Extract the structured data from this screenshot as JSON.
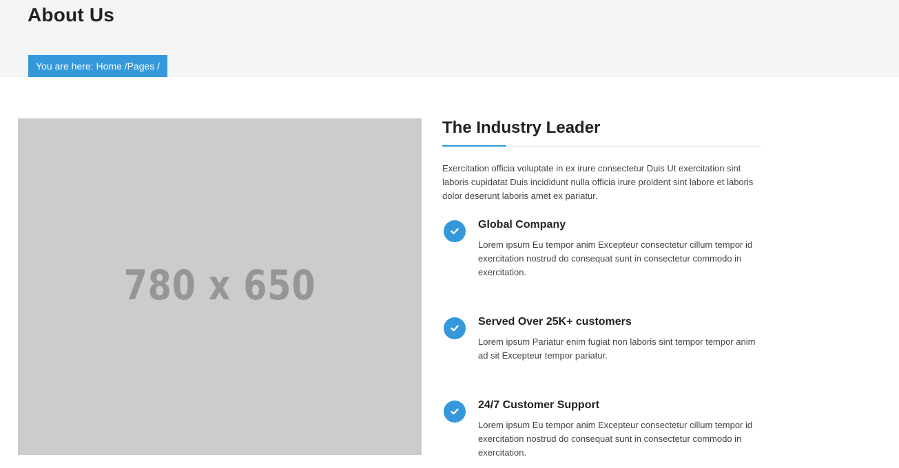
{
  "header": {
    "title": "About Us",
    "breadcrumb": {
      "prefix": "You are here: ",
      "items": [
        "Home /",
        "Pages /"
      ]
    }
  },
  "image": {
    "placeholder_text": "780 x 650"
  },
  "section": {
    "title": "The Industry Leader",
    "intro": "Exercitation officia voluptate in ex irure consectetur Duis Ut exercitation sint laboris cupidatat Duis incididunt nulla officia irure proident sint labore et laboris dolor deserunt laboris amet ex pariatur.",
    "features": [
      {
        "icon": "check-circle-icon",
        "title": "Global Company",
        "text": "Lorem ipsum Eu tempor anim Excepteur consectetur cillum tempor id exercitation nostrud do consequat sunt in consectetur commodo in exercitation."
      },
      {
        "icon": "check-circle-icon",
        "title": "Served Over 25K+ customers",
        "text": "Lorem ipsum Pariatur enim fugiat non laboris sint tempor tempor anim ad sit Excepteur tempor pariatur."
      },
      {
        "icon": "check-circle-icon",
        "title": "24/7 Customer Support",
        "text": "Lorem ipsum Eu tempor anim Excepteur consectetur cillum tempor id exercitation nostrud do consequat sunt in consectetur commodo in exercitation."
      }
    ]
  },
  "colors": {
    "accent": "#3498db",
    "header_bg": "#f5f5f5",
    "placeholder_bg": "#cccccc"
  }
}
